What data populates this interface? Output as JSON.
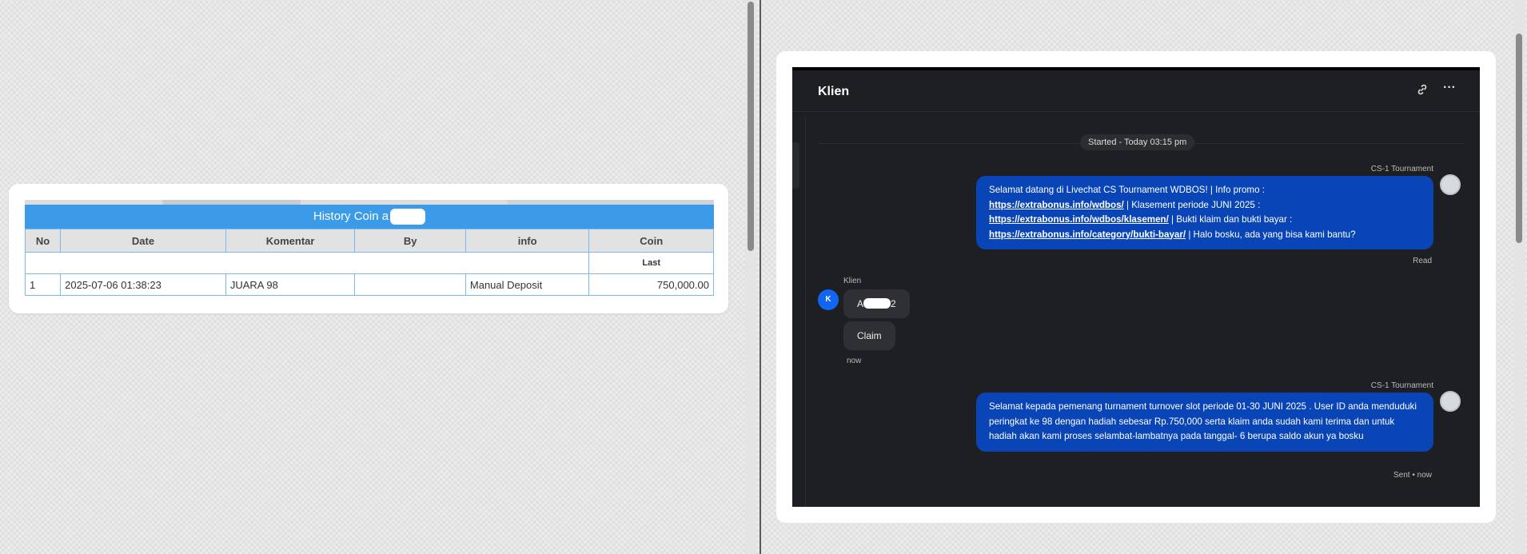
{
  "history": {
    "title": "History Coin a",
    "columns": [
      "No",
      "Date",
      "Komentar",
      "By",
      "info",
      "Coin"
    ],
    "last_label": "Last",
    "rows": [
      {
        "no": "1",
        "date": "2025-07-06 01:38:23",
        "komentar": "JUARA 98",
        "by": "",
        "info": "Manual Deposit",
        "coin": "750,000.00"
      }
    ]
  },
  "chat": {
    "title": "Klien",
    "started": "Started - Today 03:15 pm",
    "agent_name": "CS-1 Tournament",
    "client_name": "Klien",
    "client_initial": "K",
    "msg1": {
      "line1": "Selamat datang di Livechat CS Tournament WDBOS! | Info promo :",
      "link1": "https://extrabonus.info/wdbos/",
      "mid1": " | Klasement periode JUNI 2025 :",
      "link2": "https://extrabonus.info/wdbos/klasemen/",
      "mid2": " | Bukti klaim dan bukti bayar :",
      "link3": "https://extrabonus.info/category/bukti-bayar/",
      "tail": " | Halo bosku, ada yang bisa kami bantu?",
      "status": "Read"
    },
    "client_msg1_pre": "A",
    "client_msg1_post": "2",
    "client_msg2": "Claim",
    "client_time": "now",
    "msg2": {
      "text": "Selamat kepada pemenang turnament turnover slot periode 01-30 JUNI 2025 . User ID anda menduduki peringkat ke 98 dengan hadiah sebesar Rp.750,000 serta klaim anda sudah kami terima dan untuk hadiah akan kami proses selambat-lambatnya pada tanggal- 6 berupa saldo akun ya bosku",
      "status": "Sent • now"
    },
    "icons": [
      "link-icon",
      "more-icon"
    ]
  },
  "colors": {
    "accent_blue": "#3b9be9",
    "bubble_blue": "#0a45b7",
    "coin_green": "#2d8a1f"
  }
}
